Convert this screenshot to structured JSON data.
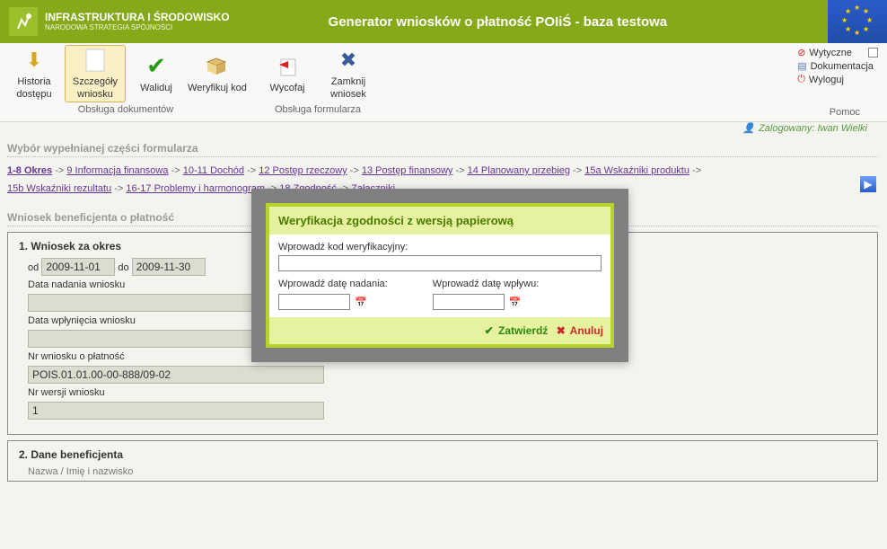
{
  "banner": {
    "logo_top": "INFRASTRUKTURA I ŚRODOWISKO",
    "logo_sub": "NARODOWA STRATEGIA SPÓJNOŚCI",
    "title": "Generator wniosków o płatność POIiŚ - baza testowa"
  },
  "ribbon": {
    "buttons": [
      {
        "id": "historia",
        "label": "Historia dostępu",
        "icon_color": "#e3b139"
      },
      {
        "id": "szczegoly",
        "label": "Szczegóły wniosku",
        "active": true
      },
      {
        "id": "waliduj",
        "label": "Waliduj"
      },
      {
        "id": "weryfikuj",
        "label": "Weryfikuj kod"
      },
      {
        "id": "wycofaj",
        "label": "Wycofaj"
      },
      {
        "id": "zamknij",
        "label": "Zamknij wniosek"
      }
    ],
    "group1": "Obsługa dokumentów",
    "group2": "Obsługa formularza",
    "right": {
      "wytyczne": "Wytyczne",
      "dokumentacja": "Dokumentacja",
      "wyloguj": "Wyloguj"
    },
    "help": "Pomoc"
  },
  "logged": "Zalogowany: Iwan Wielki",
  "sections": {
    "wybor": "Wybór wypełnianej części formularza",
    "wniosek": "Wniosek beneficjenta o płatność"
  },
  "nav": {
    "current": "1-8 Okres",
    "items": [
      "9 Informacja finansowa",
      "10-11 Dochód",
      "12 Postęp rzeczowy",
      "13 Postęp finansowy",
      "14 Planowany przebieg",
      "15a Wskaźniki produktu",
      "15b Wskaźniki rezultatu",
      "16-17 Problemy i harmonogram",
      "18 Zgodność",
      "Załączniki"
    ]
  },
  "form": {
    "h1": "1. Wniosek za okres",
    "od_lbl": "od",
    "od_val": "2009-11-01",
    "do_lbl": "do",
    "do_val": "2009-11-30",
    "data_nadania_lbl": "Data nadania wniosku",
    "data_nadania_val": "",
    "data_wplyniecia_lbl": "Data wpłynięcia wniosku",
    "data_wplyniecia_val": "",
    "nr_wniosku_lbl": "Nr wniosku o płatność",
    "nr_wniosku_val": "POIS.01.01.00-00-888/09-02",
    "nr_wersji_lbl": "Nr wersji wniosku",
    "nr_wersji_val": "1",
    "h2": "2. Dane beneficjenta",
    "h2_sub": "Nazwa / Imię i nazwisko"
  },
  "modal": {
    "title": "Weryfikacja zgodności z wersją papierową",
    "kod_lbl": "Wprowadź kod weryfikacyjny:",
    "data_nad_lbl": "Wprowadź datę nadania:",
    "data_wpl_lbl": "Wprowadź datę wpływu:",
    "ok": "Zatwierdź",
    "cancel": "Anuluj"
  }
}
